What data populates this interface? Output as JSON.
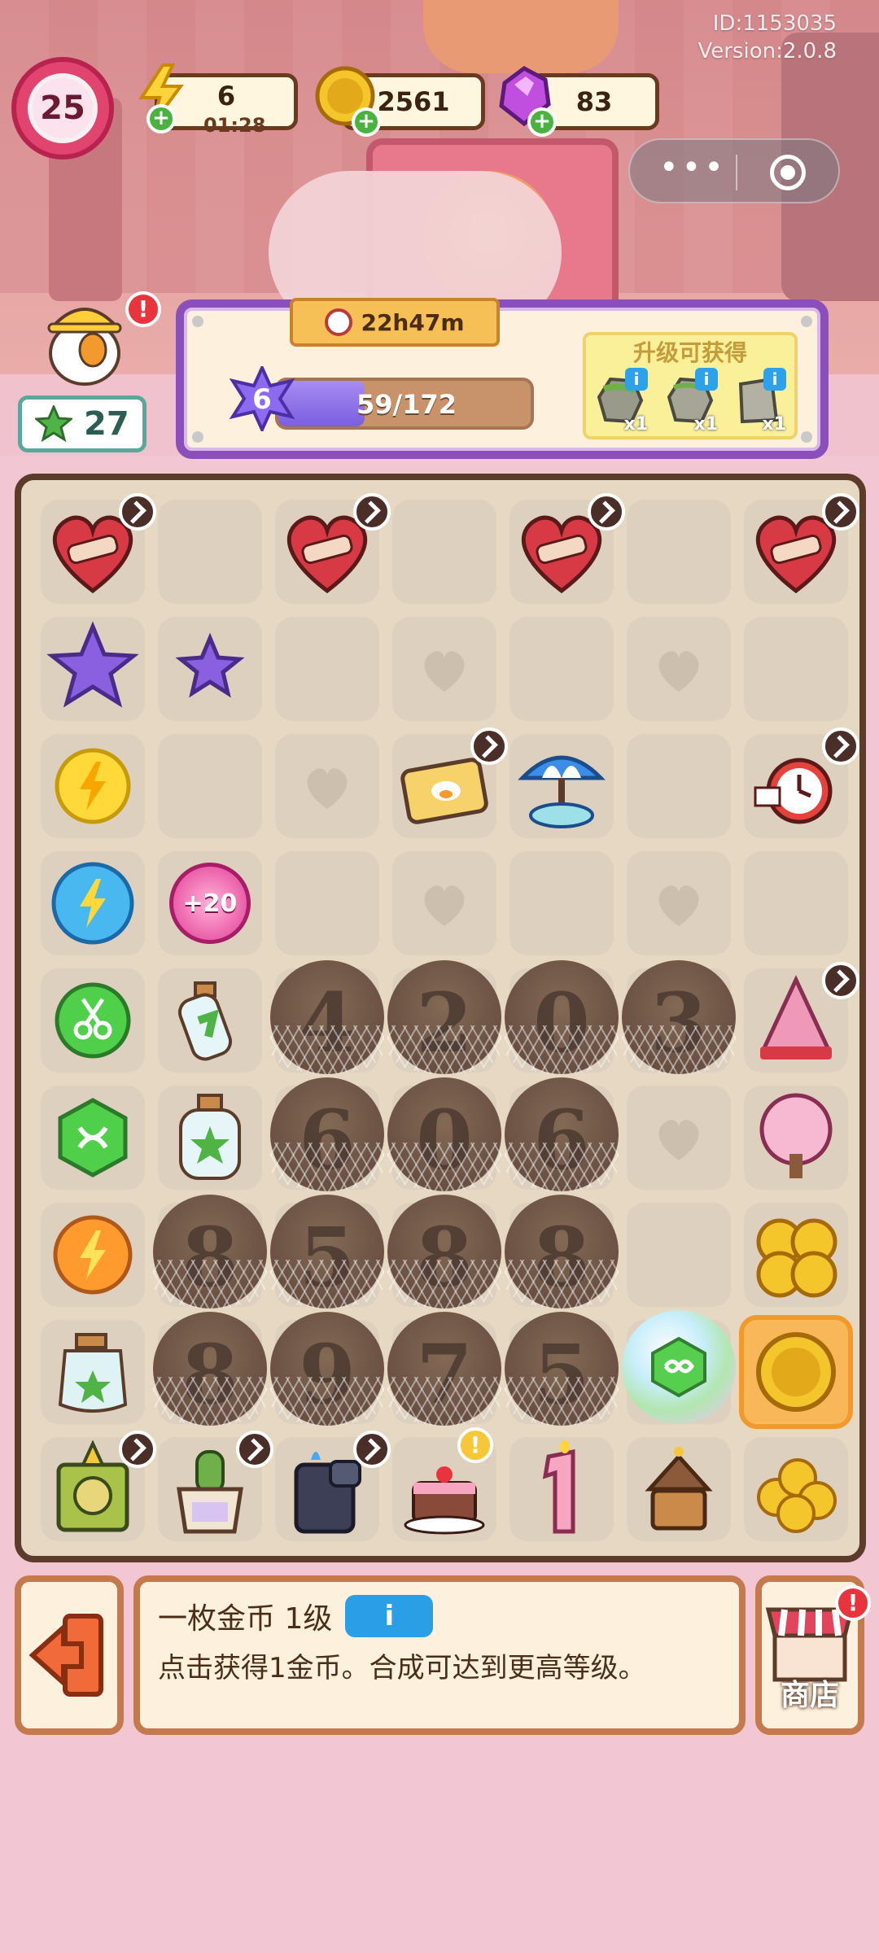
{
  "header": {
    "id_text": "ID:1153035",
    "version_text": "Version:2.0.8",
    "player_level": "25",
    "energy": {
      "value": "6",
      "timer": "01:28"
    },
    "coins": {
      "value": "2561"
    },
    "gems": {
      "value": "83"
    }
  },
  "duck": {
    "clover_count": "27"
  },
  "level_panel": {
    "timer": "22h47m",
    "level": "6",
    "progress_text": "59/172",
    "progress_fraction": 0.343,
    "reward_title": "升级可获得",
    "rewards": [
      {
        "qty": "x1",
        "info": "i"
      },
      {
        "qty": "x1",
        "info": "i"
      },
      {
        "qty": "x1",
        "info": "i"
      }
    ]
  },
  "board": {
    "locked_numbers": {
      "r4": [
        "4",
        "2",
        "0",
        "3"
      ],
      "r5": [
        "6",
        "0",
        "6"
      ],
      "r6": [
        "8",
        "5",
        "8",
        "8"
      ],
      "r7": [
        "8",
        "9",
        "7",
        "5"
      ]
    },
    "energy_bubble_label": "+20"
  },
  "info_panel": {
    "title": "一枚金币 1级",
    "info_button": "i",
    "description": "点击获得1金币。合成可达到更高等级。"
  },
  "shop": {
    "label": "商店"
  },
  "colors": {
    "accent": "#8a4fbb",
    "board_border": "#5b3b2a",
    "bg": "#f3c6d3"
  }
}
